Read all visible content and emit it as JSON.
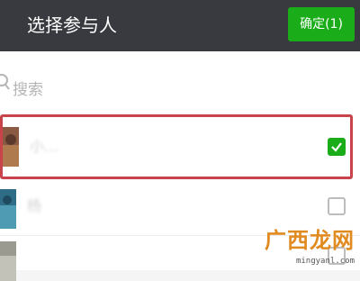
{
  "header": {
    "title": "选择参与人",
    "confirm_label": "确定(1)"
  },
  "search": {
    "placeholder": "搜索",
    "icon": "search-icon"
  },
  "contacts": [
    {
      "name": "小…",
      "checked": true
    },
    {
      "name": "杨",
      "checked": false
    },
    {
      "name": "",
      "checked": false
    }
  ],
  "watermark": {
    "text": "广西龙网",
    "url": "mingyanl.com"
  },
  "colors": {
    "header_bg": "#393a3f",
    "accent_green": "#1aad19",
    "highlight_red": "#c9434b"
  }
}
